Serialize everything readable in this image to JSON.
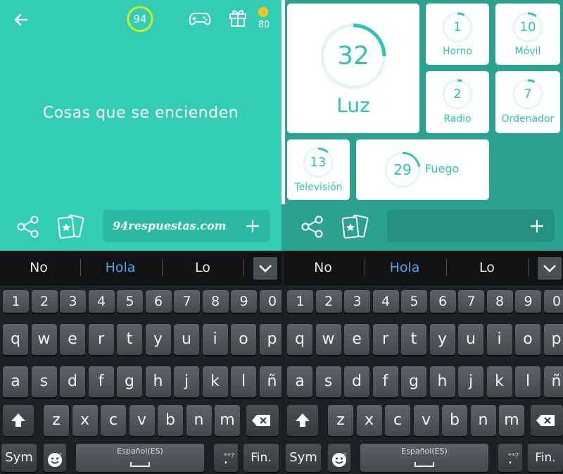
{
  "left_app": {
    "level": "94",
    "coins": "80",
    "question": "Cosas que se encienden",
    "answer_text": "94respuestas.com",
    "colors": {
      "bg": "#33cdb4",
      "coin": "#ffc21a",
      "ring": "#c5f21a"
    }
  },
  "right_app": {
    "tiles": [
      {
        "num": "32",
        "word": "Luz",
        "progress": 0.25
      },
      {
        "num": "1",
        "word": "Horno",
        "progress": 0.08
      },
      {
        "num": "10",
        "word": "Móvil",
        "progress": 0.1
      },
      {
        "num": "2",
        "word": "Radio",
        "progress": 0.05
      },
      {
        "num": "7",
        "word": "Ordenador",
        "progress": 0.08
      },
      {
        "num": "13",
        "word": "Televisión",
        "progress": 0.12
      },
      {
        "num": "29",
        "word": "Fuego",
        "progress": 0.22
      }
    ],
    "colors": {
      "bg": "#2aa28f",
      "accent": "#2ec4ad"
    }
  },
  "keyboard": {
    "suggestions": [
      "No",
      "Hola",
      "Lo"
    ],
    "numbers": [
      "1",
      "2",
      "3",
      "4",
      "5",
      "6",
      "7",
      "8",
      "9",
      "0"
    ],
    "row1": [
      "q",
      "w",
      "e",
      "r",
      "t",
      "y",
      "u",
      "i",
      "o",
      "p"
    ],
    "row2": [
      "a",
      "s",
      "d",
      "f",
      "g",
      "h",
      "j",
      "k",
      "l",
      "ñ"
    ],
    "row3": [
      "z",
      "x",
      "c",
      "v",
      "b",
      "n",
      "m"
    ],
    "sym": "Sym",
    "space_label": "Español(ES)",
    "dot": ".",
    "dot_hint": "**?",
    "emoji_hint": "**♪",
    "fin": "Fin."
  }
}
